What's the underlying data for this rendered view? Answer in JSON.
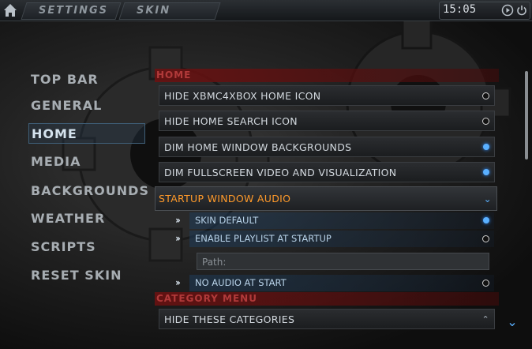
{
  "header": {
    "crumbs": [
      "SETTINGS",
      "SKIN"
    ],
    "clock": "15:05",
    "icons": [
      "home-icon",
      "play-icon",
      "power-icon"
    ]
  },
  "sidebar": {
    "items": [
      {
        "label": "TOP BAR"
      },
      {
        "label": "GENERAL"
      },
      {
        "label": "HOME"
      },
      {
        "label": "MEDIA"
      },
      {
        "label": "BACKGROUNDS"
      },
      {
        "label": "WEATHER"
      },
      {
        "label": "SCRIPTS"
      },
      {
        "label": "RESET SKIN"
      }
    ],
    "selected": "HOME"
  },
  "main": {
    "home_header": "HOME",
    "options": [
      {
        "label": "HIDE XBMC4XBOX HOME ICON",
        "enabled": false
      },
      {
        "label": "HIDE HOME SEARCH ICON",
        "enabled": false
      },
      {
        "label": "DIM HOME WINDOW BACKGROUNDS",
        "enabled": true
      },
      {
        "label": "DIM FULLSCREEN VIDEO AND VISUALIZATION",
        "enabled": true
      }
    ],
    "startup_audio": {
      "label": "STARTUP WINDOW AUDIO",
      "choices": [
        {
          "label": "SKIN DEFAULT",
          "enabled": true
        },
        {
          "label": "ENABLE PLAYLIST AT STARTUP",
          "enabled": false
        },
        {
          "label": "NO AUDIO AT START",
          "enabled": false
        }
      ],
      "path_placeholder": "Path:"
    },
    "category_header": "CATEGORY MENU",
    "hide_categories": "HIDE THESE CATEGORIES"
  },
  "colors": {
    "accent": "#5ab0ff",
    "header_red": "#b13a3a",
    "expand_orange": "#ff9a2a"
  }
}
